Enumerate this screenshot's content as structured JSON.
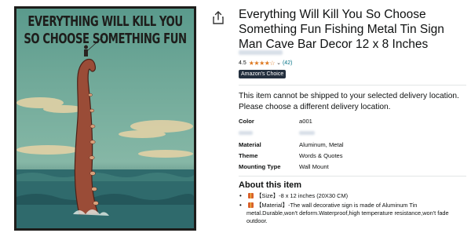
{
  "poster": {
    "line1": "EVERYTHING WILL KILL YOU",
    "line2": "SO CHOOSE SOMETHING FUN"
  },
  "product": {
    "title": "Everything Will Kill You So Choose Something Fun Fishing Metal Tin Sign Man Cave Bar Decor 12 x 8 Inches",
    "rating_value": "4.5",
    "stars": "★★★★☆",
    "rating_count": "(42)",
    "badge": "Amazon's Choice",
    "notice": "This item cannot be shipped to your selected delivery location. Please choose a different delivery location."
  },
  "specs": {
    "color_label": "Color",
    "color_value": "a001",
    "material_label": "Material",
    "material_value": "Aluminum, Metal",
    "theme_label": "Theme",
    "theme_value": "Words & Quotes",
    "mounting_label": "Mounting Type",
    "mounting_value": "Wall Mount"
  },
  "about": {
    "heading": "About this item",
    "bullet1": "【Size】-8 x 12 inches (20X30 CM)",
    "bullet2": "【Material】-The wall decorative sign is made of Aluminum Tin metal.Durable,won't deform.Waterproof,high temperature resistance,won't fade outdoor."
  },
  "colors": {
    "badge_bg": "#232f3e",
    "star": "#de7921",
    "link": "#007185"
  },
  "icons": {
    "share": "share-icon",
    "gift": "gift-icon",
    "chevron": "chevron-down-icon"
  }
}
